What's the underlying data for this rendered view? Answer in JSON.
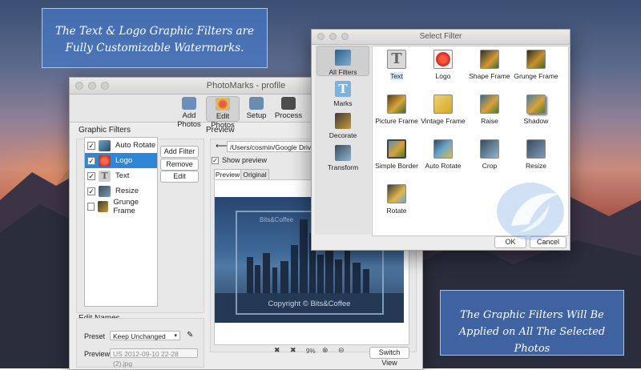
{
  "banners": {
    "top": "The Text & Logo Graphic Filters are Fully Customizable Watermarks.",
    "bottom": "The Graphic Filters Will Be Applied on All The Selected Photos"
  },
  "main_window": {
    "title": "PhotoMarks - profile",
    "toolbar": [
      {
        "label": "Add Photos",
        "icon": "add-photos-icon"
      },
      {
        "label": "Edit Photos",
        "icon": "edit-photos-icon"
      },
      {
        "label": "Setup",
        "icon": "setup-icon"
      },
      {
        "label": "Process",
        "icon": "process-icon"
      }
    ],
    "graphic_filters": {
      "heading": "Graphic Filters",
      "items": [
        {
          "label": "Auto Rotate",
          "checked": true,
          "selected": false
        },
        {
          "label": "Logo",
          "checked": true,
          "selected": true
        },
        {
          "label": "Text",
          "checked": true,
          "selected": false
        },
        {
          "label": "Resize",
          "checked": true,
          "selected": false
        },
        {
          "label": "Grunge Frame",
          "checked": false,
          "selected": false
        }
      ],
      "buttons": {
        "add": "Add Filter",
        "remove": "Remove",
        "edit": "Edit"
      }
    },
    "preview": {
      "heading": "Preview",
      "path": "/Users/cosmin/Google Drive/Share/",
      "show_preview_label": "Show preview",
      "show_preview_checked": true,
      "tabs": [
        "Preview",
        "Original"
      ],
      "watermark_text": "Bits&Coffee",
      "copyright": "Copyright © Bits&Coffee",
      "zoom": "9%",
      "switch_view": "Switch View"
    },
    "edit_names": {
      "heading": "Edit Names",
      "preset_label": "Preset",
      "preset_value": "Keep Unchanged",
      "preview_label": "Preview",
      "preview_value": "US 2012-09-10 22-28 (2).jpg"
    }
  },
  "dialog": {
    "title": "Select Filter",
    "categories": [
      {
        "label": "All Filters",
        "selected": true
      },
      {
        "label": "Marks",
        "selected": false
      },
      {
        "label": "Decorate",
        "selected": false
      },
      {
        "label": "Transform",
        "selected": false
      }
    ],
    "filters": [
      {
        "label": "Text",
        "selected": true
      },
      {
        "label": "Logo",
        "selected": false
      },
      {
        "label": "Shape Frame",
        "selected": false
      },
      {
        "label": "Grunge Frame",
        "selected": false
      },
      {
        "label": "Picture Frame",
        "selected": false
      },
      {
        "label": "Vintage Frame",
        "selected": false
      },
      {
        "label": "Raise",
        "selected": false
      },
      {
        "label": "Shadow",
        "selected": false
      },
      {
        "label": "Simple Border",
        "selected": false
      },
      {
        "label": "Auto Rotate",
        "selected": false
      },
      {
        "label": "Crop",
        "selected": false
      },
      {
        "label": "Resize",
        "selected": false
      },
      {
        "label": "Rotate",
        "selected": false
      }
    ],
    "ok": "OK",
    "cancel": "Cancel"
  },
  "colors": {
    "selection": "#2f86d7",
    "banner": "#4678c8"
  }
}
